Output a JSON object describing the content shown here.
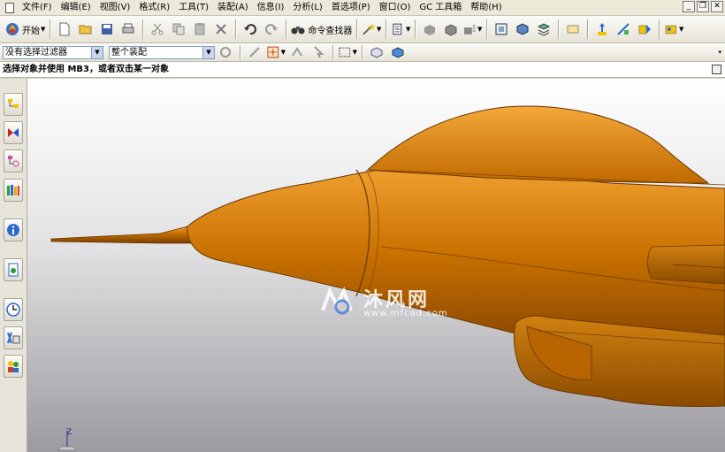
{
  "menubar": {
    "items": [
      "文件(F)",
      "编辑(E)",
      "视图(V)",
      "格式(R)",
      "工具(T)",
      "装配(A)",
      "信息(I)",
      "分析(L)",
      "首选项(P)",
      "窗口(O)",
      "GC 工具箱",
      "帮助(H)"
    ]
  },
  "toolbar": {
    "start_label": "开始",
    "command_finder_label": "命令查找器"
  },
  "selection_bar": {
    "filter_value": "没有选择过滤器",
    "scope_value": "整个装配"
  },
  "cue_line": {
    "text": "选择对象并使用 MB3，或者双击某一对象"
  },
  "viewport": {
    "watermark_text": "沐风网",
    "watermark_url": "www.mfcad.com",
    "axis_z_label": "Z",
    "model_color": "#c86f00"
  }
}
